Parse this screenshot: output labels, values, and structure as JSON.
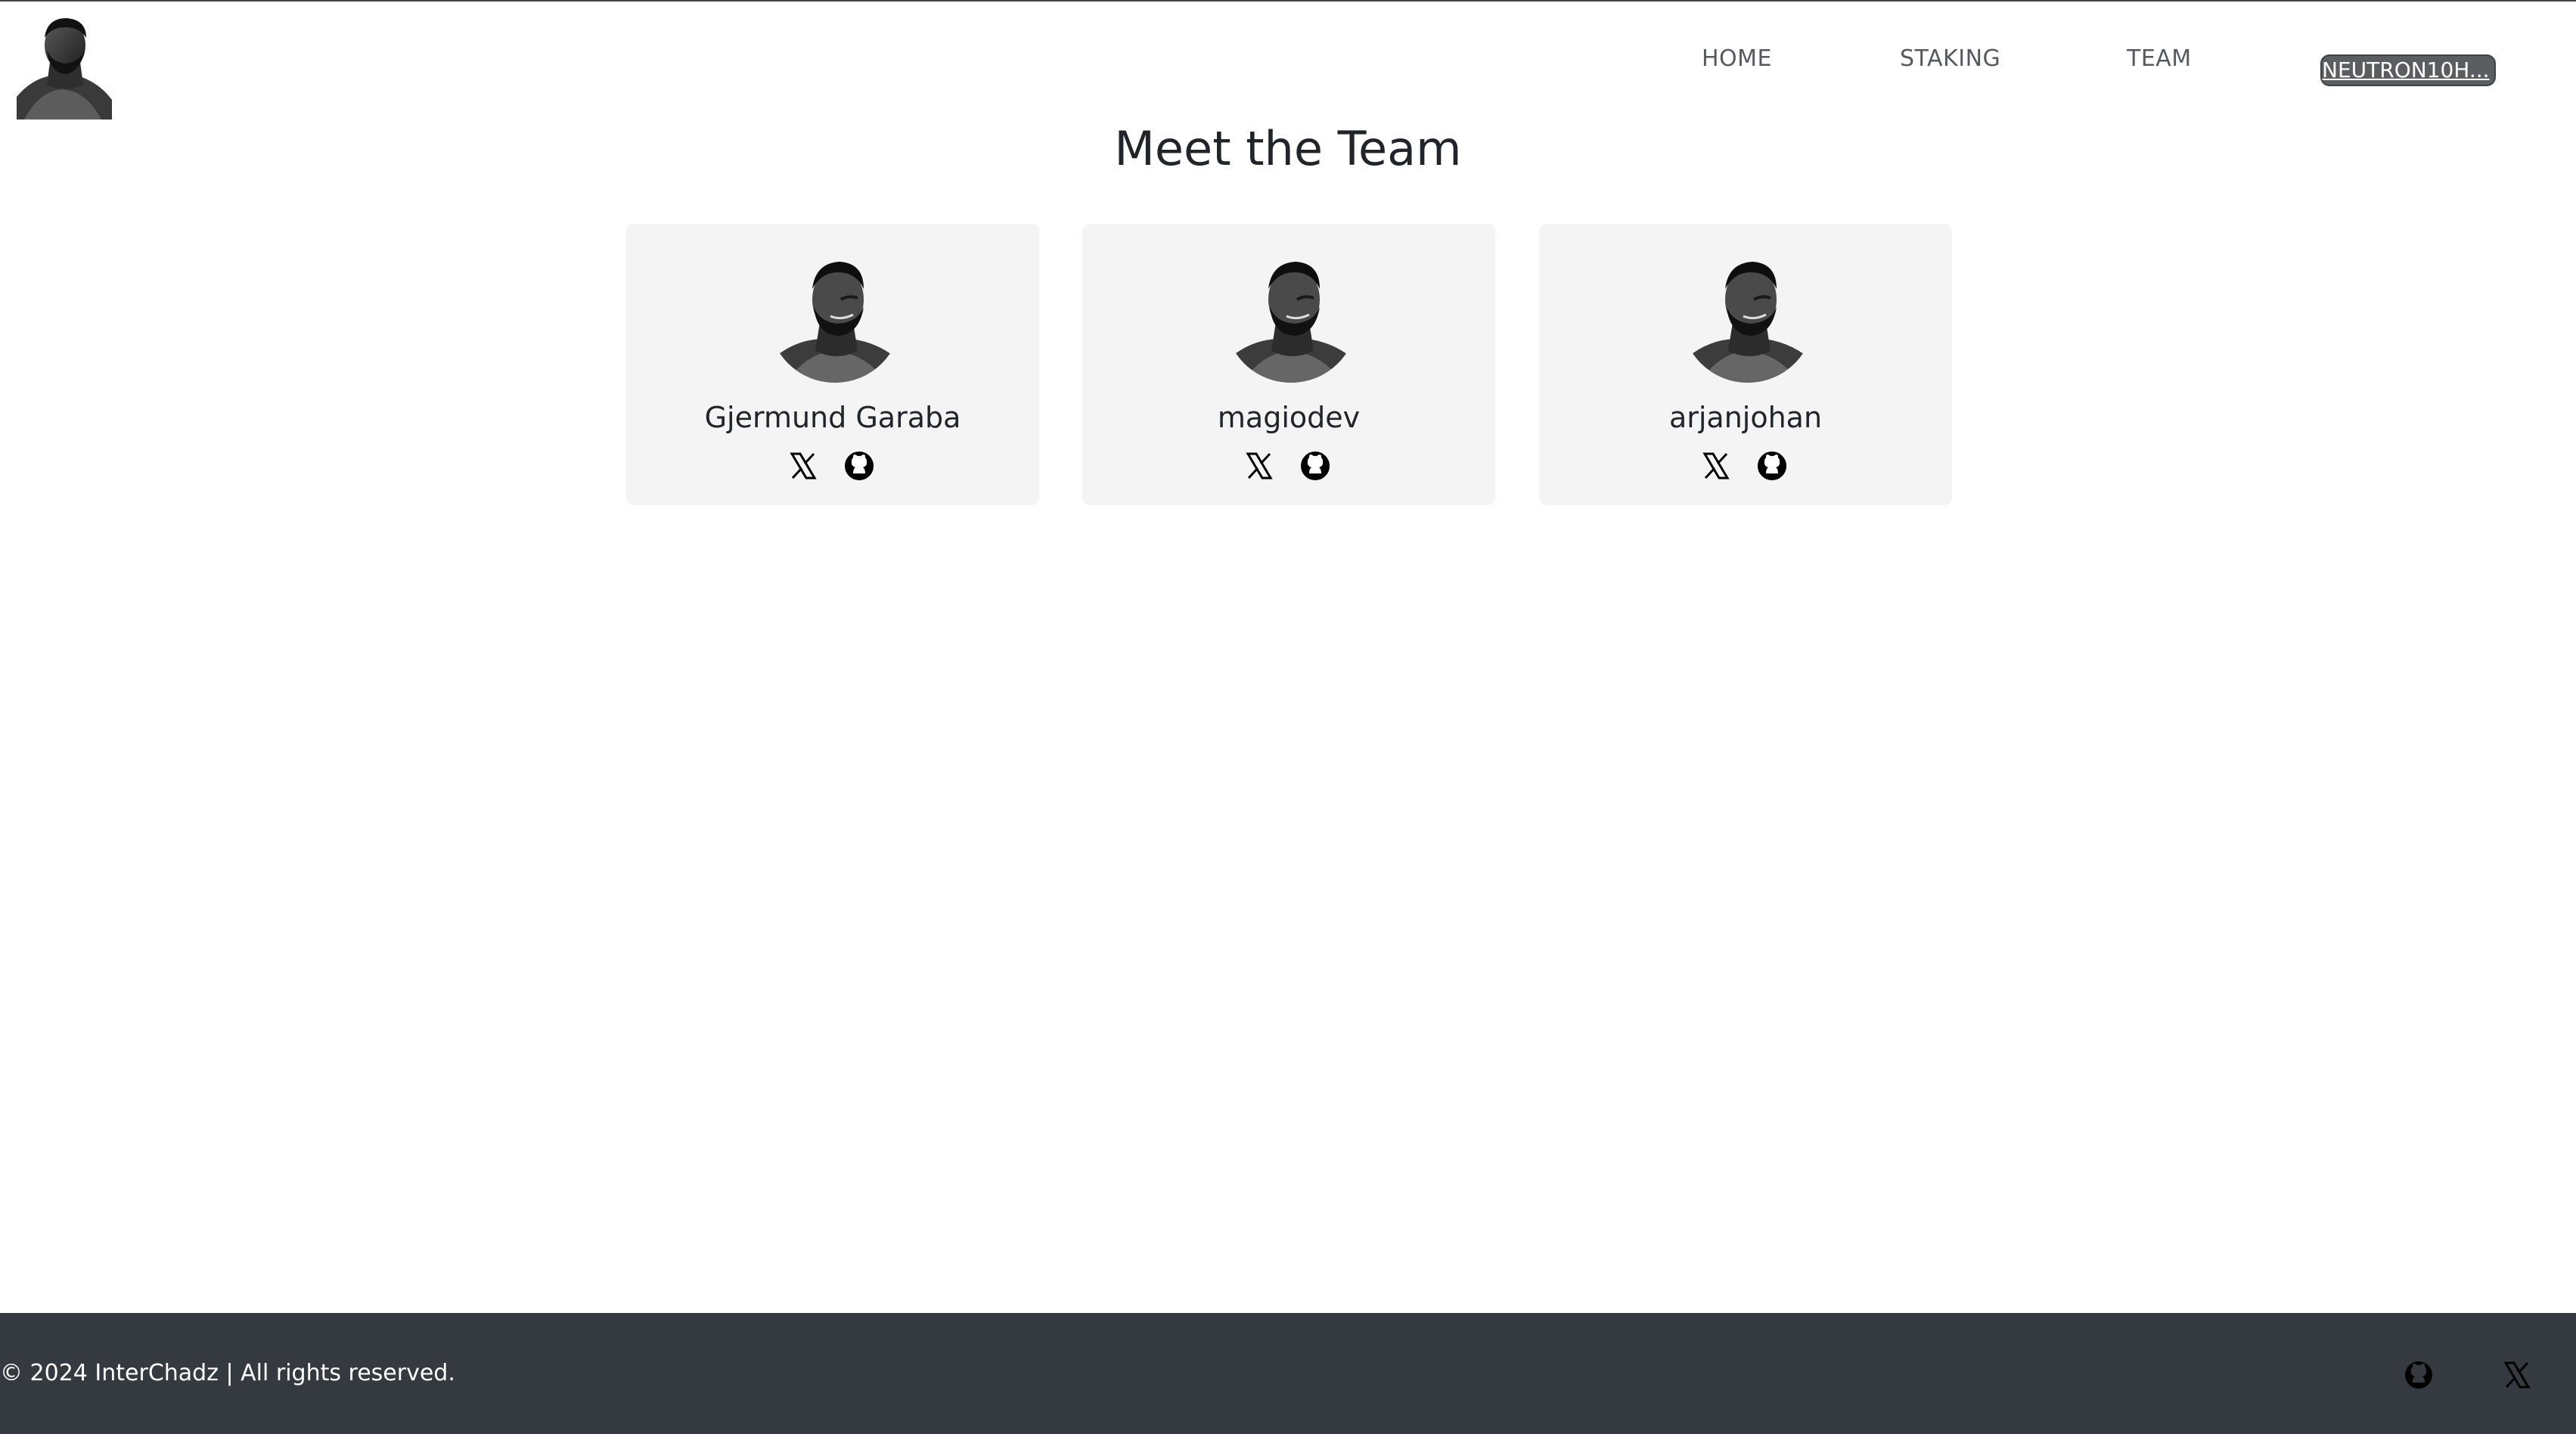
{
  "header": {
    "logo_icon": "chad-portrait-logo",
    "nav": [
      {
        "label": "HOME"
      },
      {
        "label": "STAKING"
      },
      {
        "label": "TEAM"
      }
    ],
    "wallet_label": "NEUTRON10H..."
  },
  "main": {
    "title": "Meet the Team",
    "members": [
      {
        "name": "Gjermund Garaba",
        "avatar_icon": "chad-portrait",
        "social": [
          "x-icon",
          "github-icon"
        ]
      },
      {
        "name": "magiodev",
        "avatar_icon": "chad-portrait",
        "social": [
          "x-icon",
          "github-icon"
        ]
      },
      {
        "name": "arjanjohan",
        "avatar_icon": "chad-portrait",
        "social": [
          "x-icon",
          "github-icon"
        ]
      }
    ]
  },
  "footer": {
    "copyright": "© 2024 InterChadz | All rights reserved.",
    "icons": [
      "github-icon",
      "x-icon"
    ]
  },
  "colors": {
    "footer_bg": "#343a40",
    "card_bg": "#f4f4f4",
    "wallet_bg": "#5b5e61",
    "text": "#212529"
  }
}
